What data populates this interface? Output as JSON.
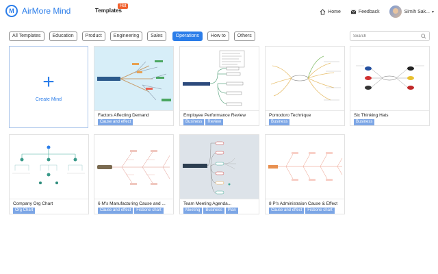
{
  "app": {
    "name": "AirMore Mind"
  },
  "nav": {
    "templates": "Templates",
    "hot": "Hot"
  },
  "header": {
    "home": "Home",
    "feedback": "Feedback",
    "user": "Simih Sak..."
  },
  "filters": [
    "All Templates",
    "Education",
    "Product",
    "Engineering",
    "Sales",
    "Operations",
    "How to",
    "Others"
  ],
  "active_filter": "Operations",
  "search": {
    "placeholder": "Search"
  },
  "create": {
    "label": "Create Mind"
  },
  "cards": [
    {
      "title": "Factors Affecting Demand",
      "tags": [
        "Cause and effect"
      ]
    },
    {
      "title": "Employee Performance Review",
      "tags": [
        "Business",
        "Review"
      ]
    },
    {
      "title": "Pomodoro Technique",
      "tags": [
        "Business"
      ]
    },
    {
      "title": "Six Thinking Hats",
      "tags": [
        "Business"
      ]
    },
    {
      "title": "Company Org Chart",
      "tags": [
        "Org Chart"
      ]
    },
    {
      "title": "6 M's Manufacturing Cause and ...",
      "tags": [
        "Cause and effect",
        "Fisbone chart"
      ]
    },
    {
      "title": "Team Meeting Agenda...",
      "tags": [
        "Meeting",
        "Business",
        "Plan"
      ]
    },
    {
      "title": "8 P's Administraion Cause & Effect",
      "tags": [
        "Cause and effect",
        "Fisbone chart"
      ]
    }
  ],
  "colors": {
    "accent": "#2b7de9",
    "tag": "#7ca6e6",
    "hot": "#f0612e"
  }
}
